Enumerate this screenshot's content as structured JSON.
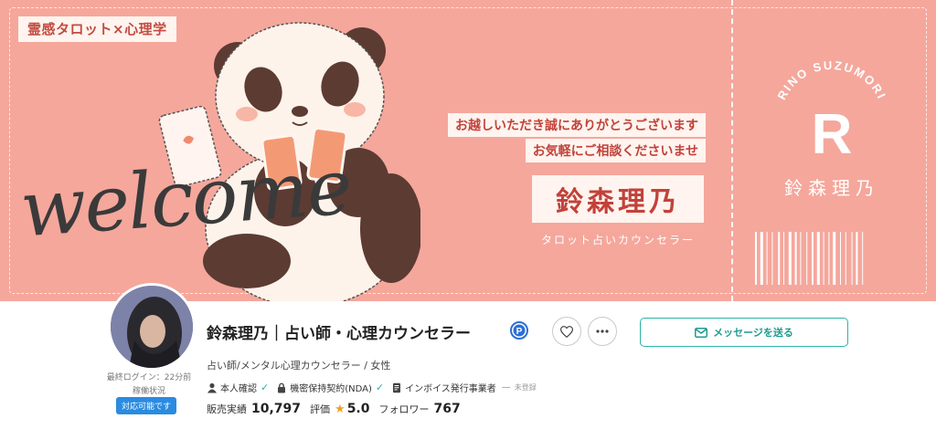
{
  "banner": {
    "tag": "霊感タロット×心理学",
    "welcome": "welcome",
    "greeting_line1": "お越しいただき誠にありがとうございます",
    "greeting_line2": "お気軽にご相談くださいませ",
    "name": "鈴森理乃",
    "subtitle": "タロット占いカウンセラー",
    "stub_arc_text": "RINO SUZUMORI",
    "stub_letter": "R",
    "stub_name": "鈴森理乃",
    "colors": {
      "background": "#f5a79c",
      "accent": "#c2423a",
      "label_bg": "#fff4ef"
    }
  },
  "profile": {
    "last_login": "最終ログイン：22分前",
    "status_label": "稼働状況",
    "status_badge": "対応可能です",
    "title": "鈴森理乃｜占い師・心理カウンセラー",
    "badge_icon": "p-badge-icon",
    "profession": "占い師/メンタル心理カウンセラー / 女性",
    "verifications": [
      {
        "icon": "person-icon",
        "label": "本人確認"
      },
      {
        "icon": "lock-icon",
        "label": "機密保持契約(NDA)"
      },
      {
        "icon": "document-icon",
        "label": "インボイス発行事業者"
      }
    ],
    "invoice_status": "未登録",
    "stats": {
      "sales_label": "販売実績",
      "sales_value": "10,797",
      "rating_label": "評価",
      "rating_value": "5.0",
      "followers_label": "フォロワー",
      "followers_value": "767"
    },
    "message_button": "メッセージを送る",
    "colors": {
      "teal": "#2bb3a4",
      "badge_blue": "#2a8be0",
      "star": "#f0a020"
    }
  }
}
